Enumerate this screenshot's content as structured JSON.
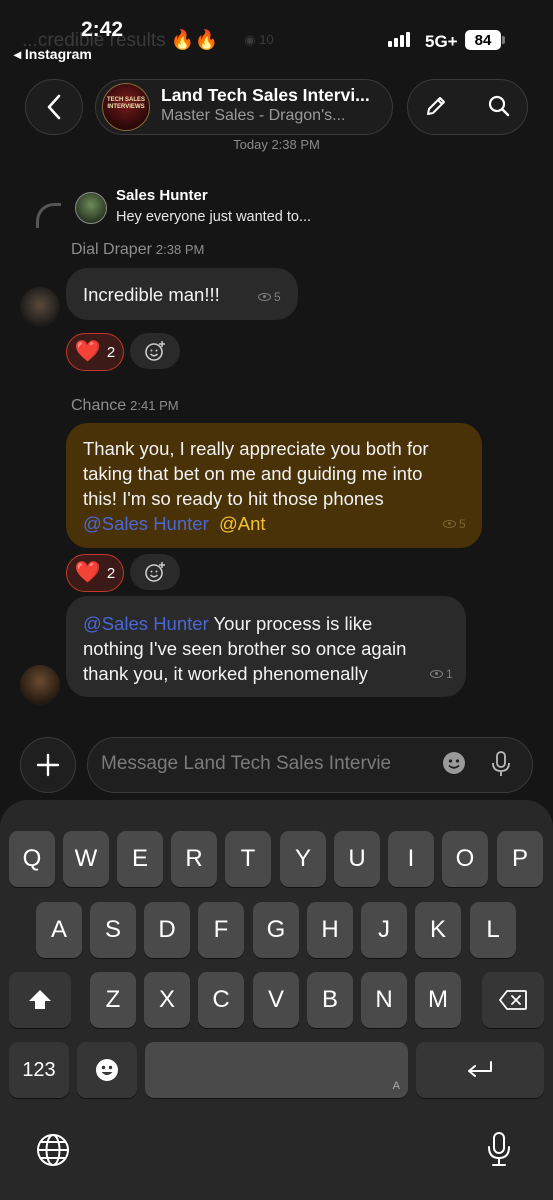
{
  "status": {
    "time": "2:42",
    "back_app": "◂ Instagram",
    "network": "5G+",
    "battery": "84"
  },
  "faded_preview": {
    "text": "...credible results 🔥🔥",
    "views": "10"
  },
  "header": {
    "title": "Land Tech Sales Intervi...",
    "subtitle": "Master Sales - Dragon's...",
    "avatar_text": "TECH SALES INTERVIEWS"
  },
  "date_line": "Today 2:38 PM",
  "messages": [
    {
      "reply": {
        "author": "Sales Hunter",
        "text": "Hey everyone just wanted to..."
      },
      "sender": "Dial Draper",
      "time": "2:38 PM",
      "text": "Incredible man!!!",
      "views": "5",
      "reaction": {
        "emoji": "❤️",
        "count": "2"
      }
    },
    {
      "sender": "Chance",
      "time": "2:41 PM",
      "lines": [
        "Thank you, I really appreciate you both for",
        "taking that bet on me and guiding me into",
        "this! I'm so ready to hit those phones"
      ],
      "mention1": "@Sales Hunter",
      "mention2": "@Ant",
      "views": "5",
      "reaction": {
        "emoji": "❤️",
        "count": "2"
      }
    },
    {
      "mention": "@Sales Hunter",
      "line1": " Your process is like",
      "line2": "nothing I've seen brother so once again",
      "line3": "thank you, it worked phenomenally",
      "views": "1"
    }
  ],
  "composer": {
    "placeholder": "Message Land Tech Sales Intervie"
  },
  "keyboard": {
    "row1": [
      "Q",
      "W",
      "E",
      "R",
      "T",
      "Y",
      "U",
      "I",
      "O",
      "P"
    ],
    "row2": [
      "A",
      "S",
      "D",
      "F",
      "G",
      "H",
      "J",
      "K",
      "L"
    ],
    "row3": [
      "Z",
      "X",
      "C",
      "V",
      "B",
      "N",
      "M"
    ],
    "numbers": "123",
    "space_hint": "A"
  },
  "icons": [
    "chevron-left-icon",
    "pencil-icon",
    "search-icon",
    "plus-icon",
    "emoji-icon",
    "mic-icon",
    "globe-icon",
    "shift-icon",
    "delete-icon",
    "return-icon",
    "smile-plus-icon",
    "eye-icon"
  ]
}
